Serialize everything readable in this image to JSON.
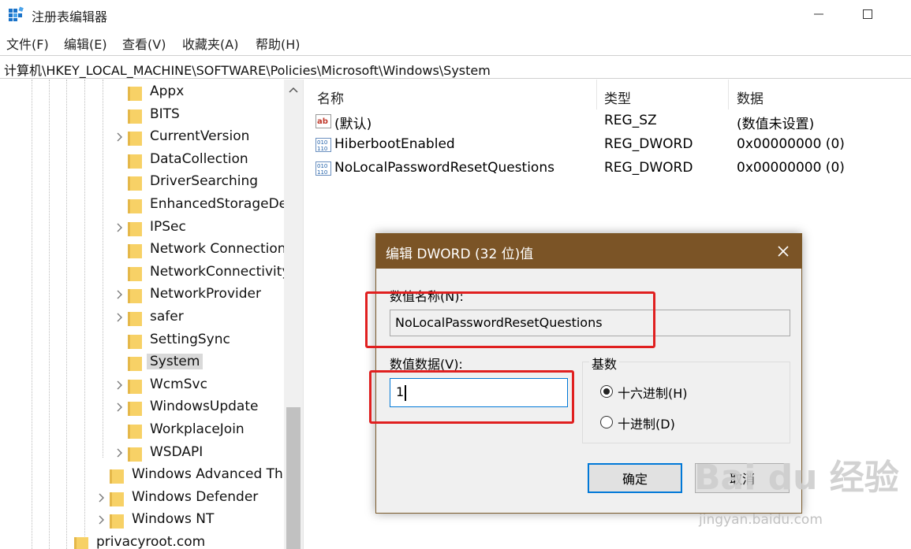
{
  "window": {
    "title": "注册表编辑器",
    "menu": [
      "文件(F)",
      "编辑(E)",
      "查看(V)",
      "收藏夹(A)",
      "帮助(H)"
    ],
    "address": "计算机\\HKEY_LOCAL_MACHINE\\SOFTWARE\\Policies\\Microsoft\\Windows\\System"
  },
  "tree": {
    "items": [
      {
        "label": "Appx",
        "expandable": false
      },
      {
        "label": "BITS",
        "expandable": false
      },
      {
        "label": "CurrentVersion",
        "expandable": true
      },
      {
        "label": "DataCollection",
        "expandable": false
      },
      {
        "label": "DriverSearching",
        "expandable": false
      },
      {
        "label": "EnhancedStorageDe",
        "expandable": false
      },
      {
        "label": "IPSec",
        "expandable": true
      },
      {
        "label": "Network Connection",
        "expandable": false
      },
      {
        "label": "NetworkConnectivity",
        "expandable": false
      },
      {
        "label": "NetworkProvider",
        "expandable": true
      },
      {
        "label": "safer",
        "expandable": true
      },
      {
        "label": "SettingSync",
        "expandable": false
      },
      {
        "label": "System",
        "expandable": false,
        "selected": true
      },
      {
        "label": "WcmSvc",
        "expandable": true
      },
      {
        "label": "WindowsUpdate",
        "expandable": true
      },
      {
        "label": "WorkplaceJoin",
        "expandable": false
      },
      {
        "label": "WSDAPI",
        "expandable": true
      },
      {
        "label": "Windows Advanced Thr",
        "expandable": false
      },
      {
        "label": "Windows Defender",
        "expandable": true
      },
      {
        "label": "Windows NT",
        "expandable": true
      },
      {
        "label": "privacyroot.com",
        "expandable": false
      }
    ]
  },
  "list": {
    "headers": {
      "name": "名称",
      "type": "类型",
      "data": "数据"
    },
    "rows": [
      {
        "icon": "string-value-icon",
        "name": "(默认)",
        "type": "REG_SZ",
        "data": "(数值未设置)"
      },
      {
        "icon": "dword-value-icon",
        "name": "HiberbootEnabled",
        "type": "REG_DWORD",
        "data": "0x00000000 (0)"
      },
      {
        "icon": "dword-value-icon",
        "name": "NoLocalPasswordResetQuestions",
        "type": "REG_DWORD",
        "data": "0x00000000 (0)"
      }
    ]
  },
  "dialog": {
    "title": "编辑 DWORD (32 位)值",
    "value_name_label": "数值名称(N):",
    "value_name": "NoLocalPasswordResetQuestions",
    "value_data_label": "数值数据(V):",
    "value_data": "1",
    "base_label": "基数",
    "hex_label": "十六进制(H)",
    "dec_label": "十进制(D)",
    "base_selected": "hex",
    "ok_label": "确定",
    "cancel_label": "取消"
  },
  "watermark": {
    "main": "Bai du 经验",
    "sub": "jingyan.baidu.com"
  },
  "colors": {
    "dialog_title_bg": "#7b5426",
    "highlight": "#e02020",
    "folder": "#f7d166",
    "selection": "#d9d9d9"
  }
}
